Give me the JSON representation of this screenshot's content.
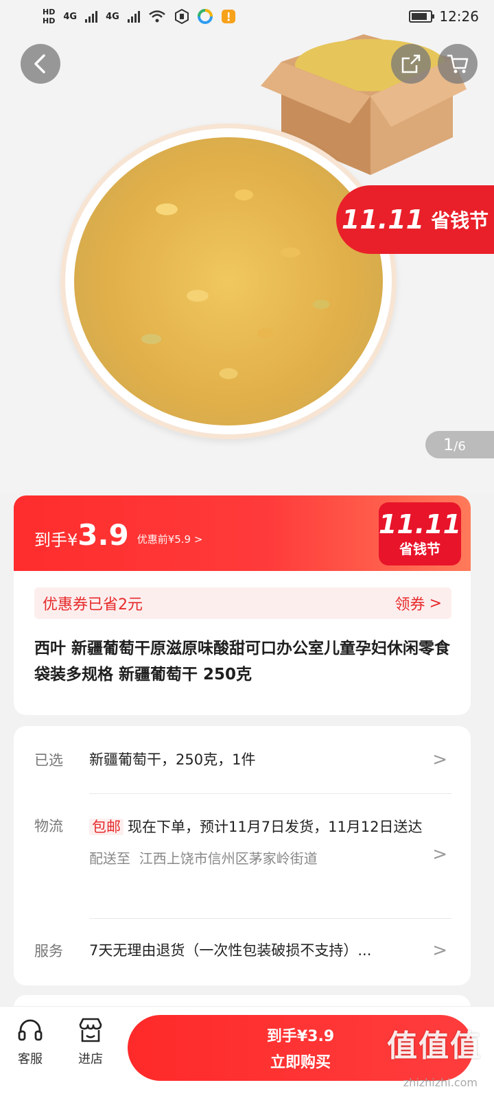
{
  "status_bar": {
    "sim1": "HD",
    "sim2": "HD",
    "net1": "4G",
    "net2": "4G",
    "time": "12:26",
    "battery_level": 0.85
  },
  "hero": {
    "promo_11": "11.11",
    "promo_label": "省钱节",
    "page_current": "1",
    "page_total": "/6"
  },
  "price": {
    "prefix": "到手¥",
    "value": "3.9",
    "before": "优惠前¥5.9 >",
    "badge_11": "11.11",
    "badge_label": "省钱节"
  },
  "coupon": {
    "text": "优惠券已省2元",
    "action": "领券",
    "action_chevron": ">"
  },
  "title": "西叶 新疆葡萄干原滋原味酸甜可口办公室儿童孕妇休闲零食袋装多规格 新疆葡萄干 250克",
  "info": {
    "selected_label": "已选",
    "selected_value": "新疆葡萄干，250克，1件",
    "logistics_label": "物流",
    "free_shipping": "包邮",
    "logistics_value": "现在下单，预计11月7日发货，11月12日送达",
    "address_prefix": "配送至",
    "address": "江西上饶市信州区茅家岭街道",
    "service_label": "服务",
    "service_value": "7天无理由退货（一次性包装破损不支持）...",
    "chevron": ">"
  },
  "bottom_bar": {
    "service_label": "客服",
    "store_label": "进店",
    "buy_price": "到手¥3.9",
    "buy_action": "立即购买"
  },
  "watermark": {
    "text": "值值值",
    "url": "zhizhizhi.com"
  },
  "colors": {
    "accent": "#e9202a",
    "price_red": "#ff2d2d",
    "coupon_bg": "#fdeeee"
  }
}
